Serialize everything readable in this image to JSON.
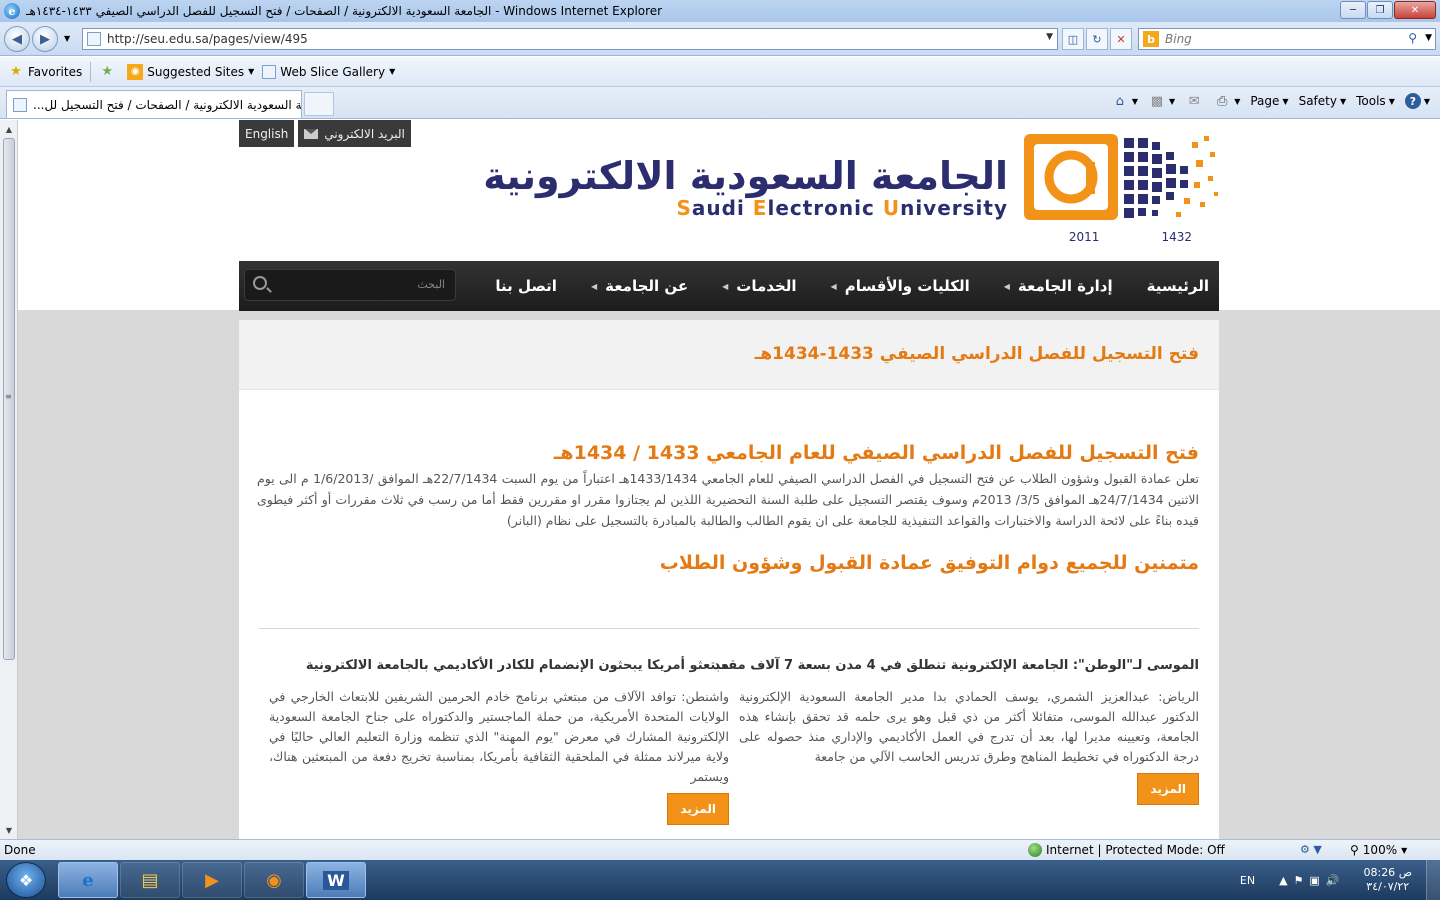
{
  "window": {
    "title": "الجامعة السعودية الالكترونية / الصفحات / فتح التسجيل للفصل الدراسي الصيفي ١٤٣٣-١٤٣٤هـ - Windows Internet Explorer",
    "ie_letter": "e"
  },
  "address": {
    "url": "http://seu.edu.sa/pages/view/495",
    "search_placeholder": "Bing",
    "bing_letter": "b"
  },
  "favorites": {
    "favorites_label": "Favorites",
    "suggested_label": "Suggested Sites",
    "gallery_label": "Web Slice Gallery"
  },
  "tabs": {
    "active_label": "...الجامعة السعودية الالكترونية / الصفحات / فتح التسجيل لل"
  },
  "commandbar": {
    "page_label": "Page",
    "safety_label": "Safety",
    "tools_label": "Tools"
  },
  "site": {
    "top_links": {
      "english": "English",
      "email": "البريد الالكتروني"
    },
    "logo": {
      "arabic": "الجامعة السعودية الالكترونية",
      "english_parts": [
        "S",
        "audi ",
        "E",
        "lectronic ",
        "U",
        "niversity"
      ],
      "year_left": "2011",
      "year_right": "1432"
    },
    "nav": {
      "items": [
        {
          "label": "الرئيسية",
          "caret": false
        },
        {
          "label": "إدارة الجامعة",
          "caret": true
        },
        {
          "label": "الكليات والأقسام",
          "caret": true
        },
        {
          "label": "الخدمات",
          "caret": true
        },
        {
          "label": "عن الجامعة",
          "caret": true
        },
        {
          "label": "اتصل بنا",
          "caret": false
        }
      ],
      "search_placeholder": "البحث"
    },
    "page_title": "فتح التسجيل للفصل الدراسي الصيفي 1433-1434هـ",
    "article": {
      "title": "فتح التسجيل للفصل الدراسي الصيفي للعام الجامعي 1433 / 1434هـ",
      "body": "تعلن عمادة القبول وشؤون الطلاب عن فتح التسجيل في الفصل الدراسي الصيفي للعام الجامعي 1433/1434هـ اعتباراً من يوم السبت 22/7/1434هـ الموافق /1/6/2013 م الى يوم الاثنين 24/7/1434هـ الموافق 3/5/ 2013م وسوف يقتصر التسجيل على طلبة السنة التحضيرية اللذين لم يجتازوا مقرر او مقررين فقط أما من رسب في ثلاث مقررات أو أكثر فيطوى قيده بناءً على لائحة الدراسة والاختبارات والقواعد التنفيذية للجامعة على ان يقوم الطالب والطالبة بالمبادرة بالتسجيل على نظام (البانر)",
      "sign": "متمنين للجميع دوام التوفيق عمادة القبول وشؤون الطلاب"
    },
    "news": [
      {
        "title": "الموسى لـ\"الوطن\": الجامعة الإلكترونية تنطلق في 4 مدن بسعة 7 آلاف مقعد",
        "excerpt": "الرياض: عبدالعزيز الشمري، يوسف الحمادي بدا مدير الجامعة السعودية الإلكترونية الدكتور عبدالله الموسى، متفائلا أكثر من ذي قبل وهو يرى حلمه قد تحقق بإنشاء هذه الجامعة، وتعيينه مديرا لها، بعد أن تدرج في العمل الأكاديمي والإداري منذ حصوله على درجة الدكتوراه في تخطيط المناهج وطرق تدريس الحاسب الآلي من جامعة",
        "more": "المزيد"
      },
      {
        "title": "مبتعثو أمريكا يبحثون الإنضمام للكادر الأكاديمي بالجامعة الالكترونية",
        "excerpt": "واشنطن: توافد الآلاف من مبتعثي برنامج خادم الحرمين الشريفين للابتعاث الخارجي في الولايات المتحدة الأمريكية، من حملة الماجستير والدكتوراه على جناح الجامعة السعودية الإلكترونية المشارك في معرض \"يوم المهنة\" الذي تنظمه وزارة التعليم العالي حاليًا في ولاية ميرلاند ممثلة في الملحقية الثقافية بأمريكا، بمناسبة تخريج دفعة من المبتعثين هناك، ويستمر",
        "more": "المزيد"
      }
    ]
  },
  "status": {
    "done": "Done",
    "zone": "Internet | Protected Mode: Off",
    "zoom": "100%"
  },
  "taskbar": {
    "lang": "EN",
    "time": "08:26 ص",
    "date": "٣٤/٠٧/٢٢"
  },
  "colors": {
    "accent_orange": "#e47a14",
    "button_orange": "#f29219",
    "logo_navy": "#2b2d6e",
    "nav_dark": "#222222"
  }
}
